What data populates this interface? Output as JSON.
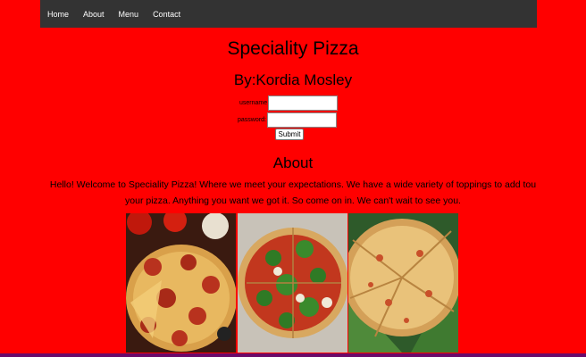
{
  "nav": {
    "items": [
      {
        "label": "Home"
      },
      {
        "label": "About"
      },
      {
        "label": "Menu"
      },
      {
        "label": "Contact"
      }
    ]
  },
  "header": {
    "title": "Speciality Pizza",
    "subtitle": "By:Kordia Mosley"
  },
  "login": {
    "username_label": "username",
    "password_label": "password:",
    "username_value": "",
    "password_value": "",
    "submit_label": "Submit"
  },
  "about": {
    "heading": "About",
    "text": "Hello! Welcome to Speciality Pizza! Where we meet your expectations. We have a wide variety of toppings to add tou your pizza. Anything you want we got it. So come on in. We can't wait to see you."
  },
  "colors": {
    "background": "#ff0000",
    "navbar": "#333333",
    "nav_text": "#ffffff"
  },
  "gallery": {
    "images": [
      {
        "name": "pepperoni-pizza-image"
      },
      {
        "name": "arugula-pizza-image"
      },
      {
        "name": "cheese-pizza-image"
      }
    ]
  }
}
